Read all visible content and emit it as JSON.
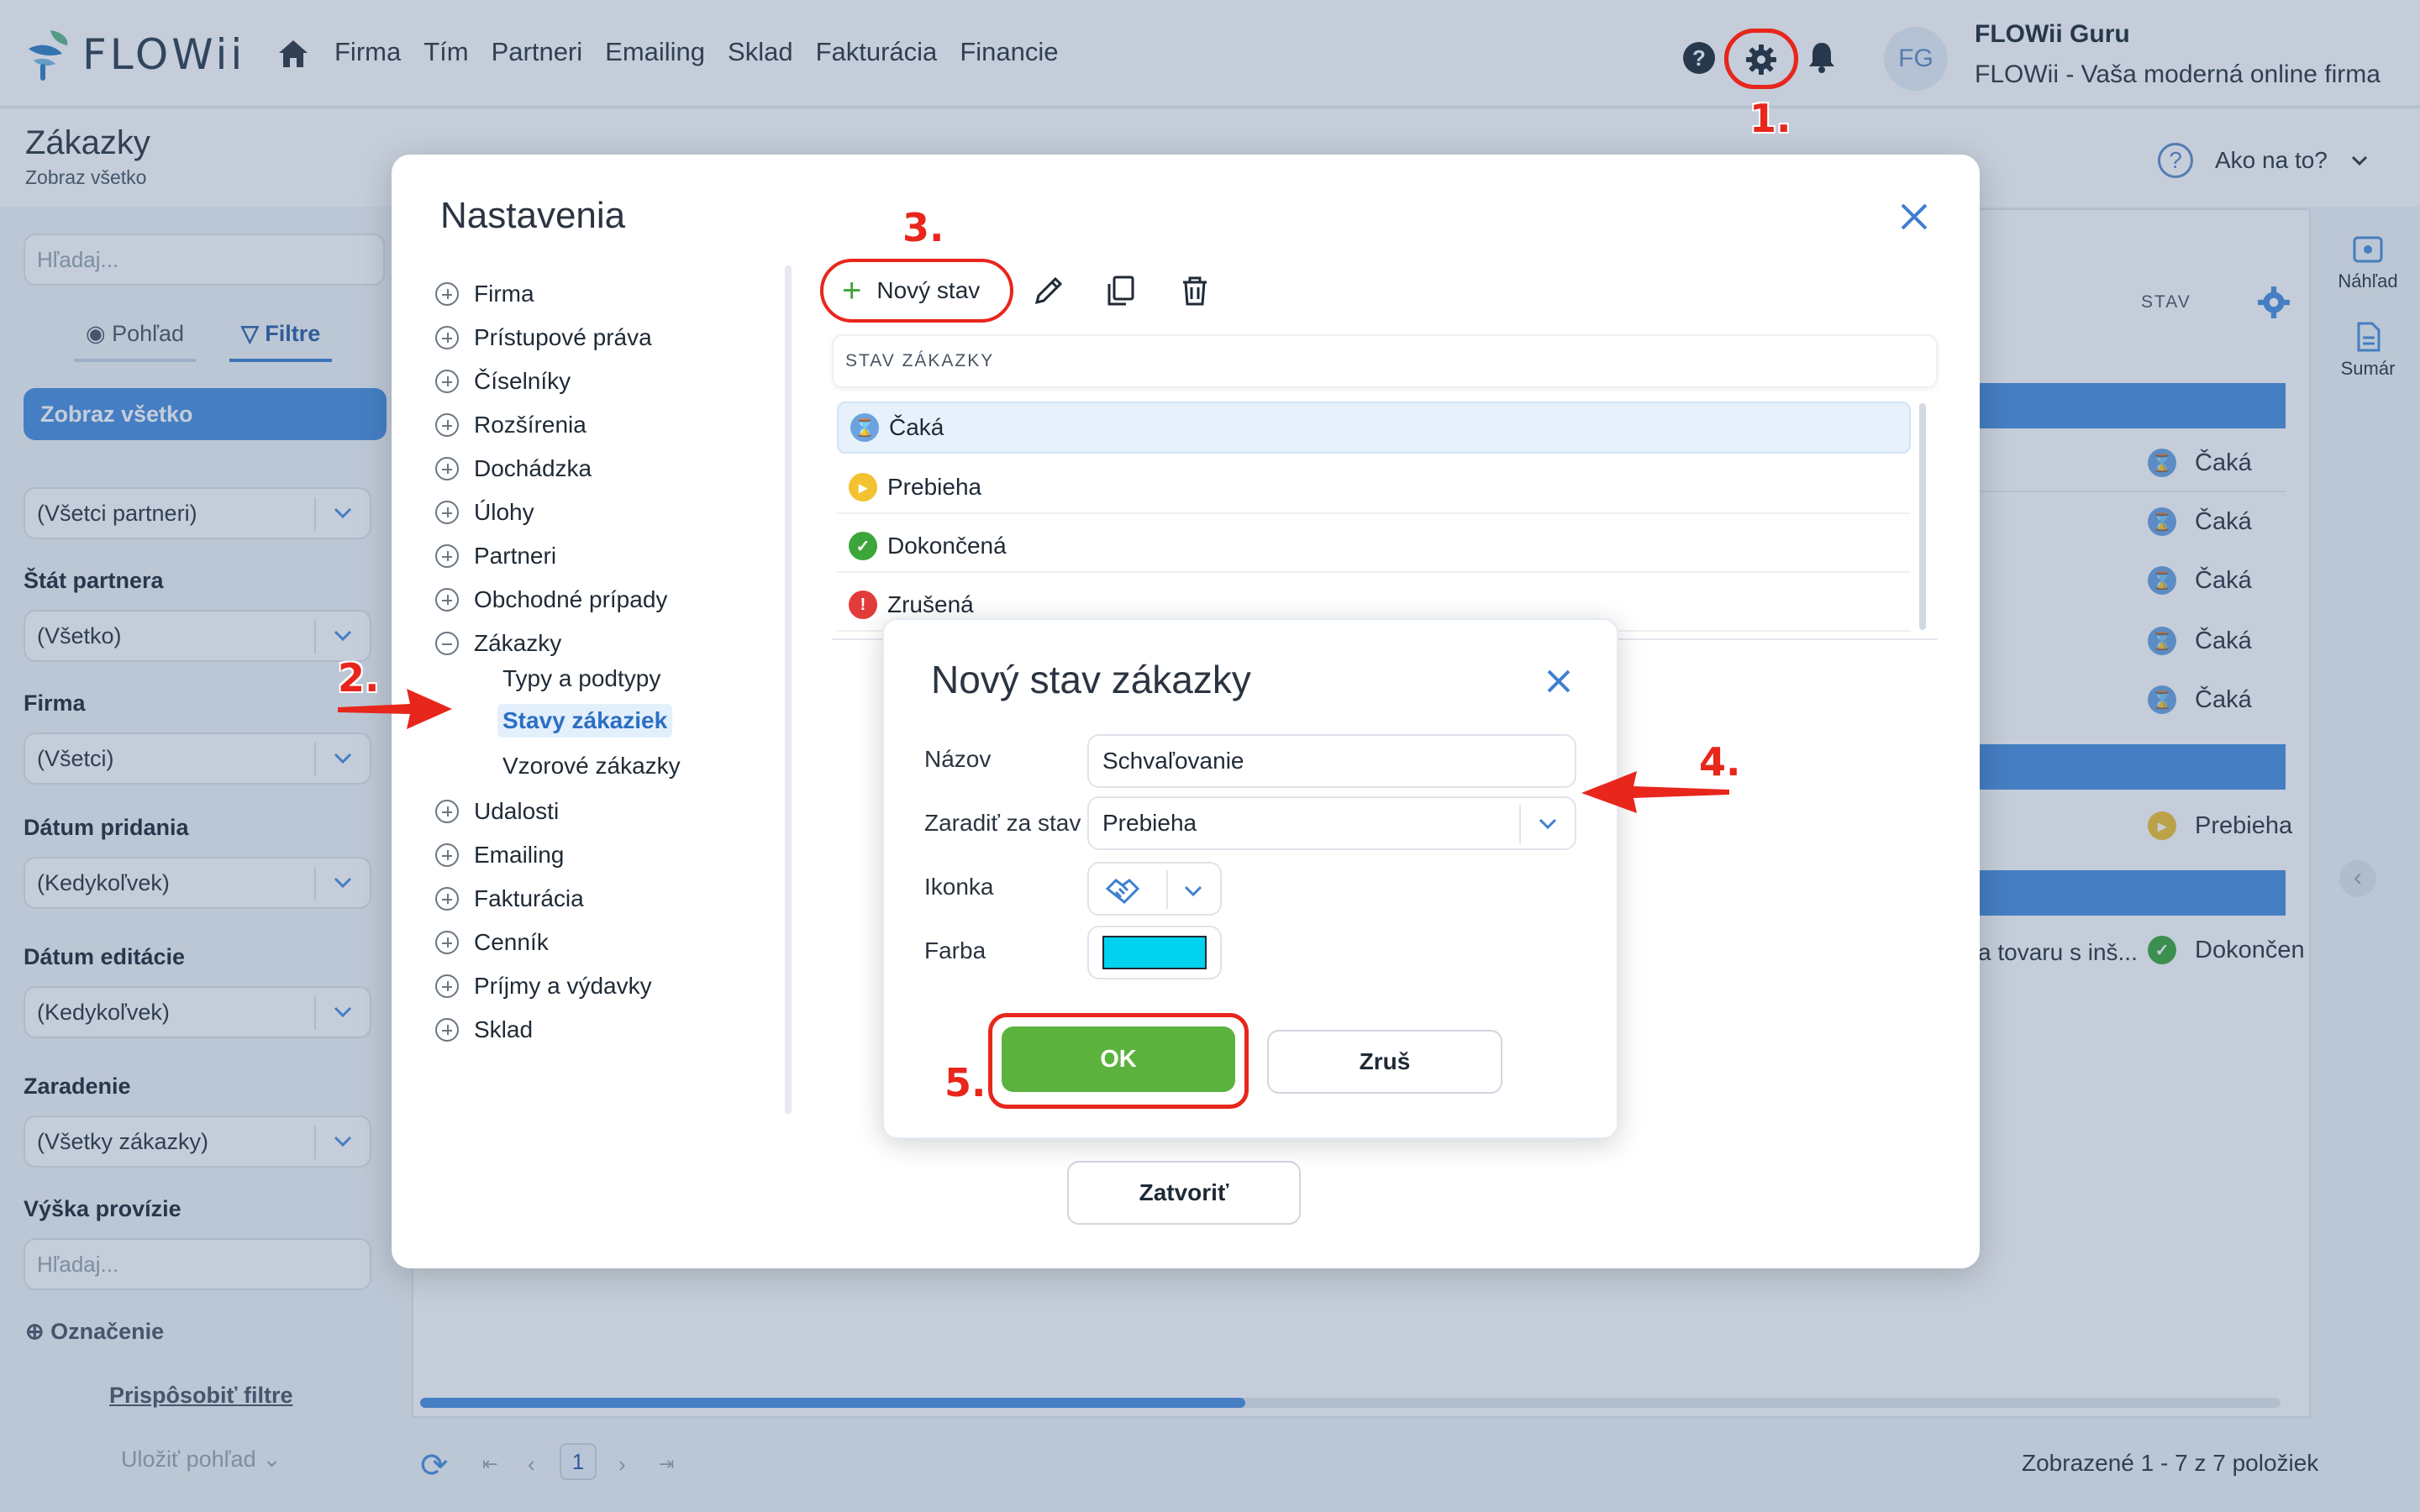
{
  "app": {
    "logo": "FLOWii",
    "nav": [
      "Firma",
      "Tím",
      "Partneri",
      "Emailing",
      "Sklad",
      "Fakturácia",
      "Financie"
    ],
    "user": {
      "initials": "FG",
      "name": "FLOWii Guru",
      "company": "FLOWii - Vaša moderná online firma"
    },
    "page_title": "Zákazky",
    "page_subtitle": "Zobraz všetko",
    "howto": "Ako na to?",
    "annotations": {
      "a1": "1.",
      "a2": "2.",
      "a3": "3.",
      "a4": "4.",
      "a5": "5."
    }
  },
  "left_panel": {
    "search_placeholder": "Hľadaj...",
    "tab_view": "Pohľad",
    "tab_filters": "Filtre",
    "show_all": "Zobraz všetko",
    "partners_select": "(Všetci partneri)",
    "state_label": "Štát partnera",
    "state_value": "(Všetko)",
    "company_label": "Firma",
    "company_value": "(Všetci)",
    "added_label": "Dátum pridania",
    "added_value": "(Kedykoľvek)",
    "edited_label": "Dátum editácie",
    "edited_value": "(Kedykoľvek)",
    "category_label": "Zaradenie",
    "category_value": "(Všetky zákazky)",
    "commission_label": "Výška provízie",
    "commission_placeholder": "Hľadaj...",
    "marking": "Označenie",
    "customize": "Prispôsobiť filtre",
    "save_view": "Uložiť pohľad"
  },
  "grid": {
    "col_state": "STAV",
    "rows": [
      "Čaká",
      "Čaká",
      "Čaká",
      "Čaká",
      "Čaká",
      "Prebieha",
      "Dokončen"
    ],
    "truncated_text": "a tovaru s inš...",
    "side_preview": "Náhľad",
    "side_summary": "Sumár",
    "pager_page": "1",
    "pager_info": "Zobrazené 1 - 7 z 7 položiek"
  },
  "settings": {
    "title": "Nastavenia",
    "tree": [
      "Firma",
      "Prístupové práva",
      "Číselníky",
      "Rozšírenia",
      "Dochádzka",
      "Úlohy",
      "Partneri",
      "Obchodné prípady",
      "Zákazky",
      "Udalosti",
      "Emailing",
      "Fakturácia",
      "Cenník",
      "Príjmy a výdavky",
      "Sklad"
    ],
    "tree_sub": [
      "Typy a podtypy",
      "Stavy zákaziek",
      "Vzorové zákazky"
    ],
    "new_state": "Nový stav",
    "table_header": "STAV ZÁKAZKY",
    "states": [
      "Čaká",
      "Prebieha",
      "Dokončená",
      "Zrušená"
    ],
    "close": "Zatvoriť"
  },
  "dialog": {
    "title": "Nový stav zákazky",
    "name_label": "Názov",
    "name_value": "Schvaľovanie",
    "after_label": "Zaradiť za stav",
    "after_value": "Prebieha",
    "icon_label": "Ikonka",
    "color_label": "Farba",
    "color_value": "#00d2f0",
    "ok": "OK",
    "cancel": "Zruš"
  }
}
